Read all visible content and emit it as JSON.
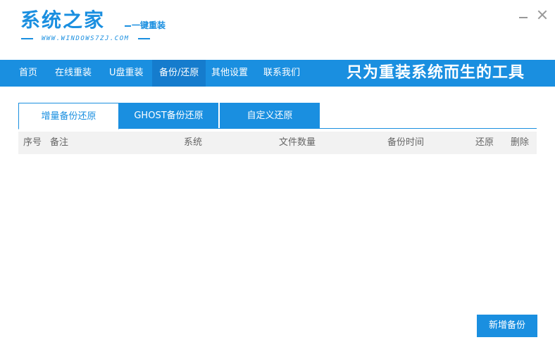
{
  "header": {
    "logo_title": "系统之家",
    "logo_subtitle": "一键重装",
    "logo_url": "WWW.WINDOWS7ZJ.COM"
  },
  "window_controls": {
    "minimize_icon": "minimize-icon",
    "close_icon": "close-icon"
  },
  "nav": {
    "items": [
      {
        "label": "首页",
        "active": false
      },
      {
        "label": "在线重装",
        "active": false
      },
      {
        "label": "U盘重装",
        "active": false
      },
      {
        "label": "备份/还原",
        "active": true
      },
      {
        "label": "其他设置",
        "active": false
      },
      {
        "label": "联系我们",
        "active": false
      }
    ],
    "slogan": "只为重装系统而生的工具"
  },
  "tabs": [
    {
      "label": "增量备份还原",
      "active": true
    },
    {
      "label": "GHOST备份还原",
      "active": false
    },
    {
      "label": "自定义还原",
      "active": false
    }
  ],
  "table": {
    "columns": [
      "序号",
      "备注",
      "系统",
      "文件数量",
      "备份时间",
      "还原",
      "删除"
    ],
    "rows": []
  },
  "actions": {
    "new_backup_label": "新增备份"
  },
  "colors": {
    "accent": "#1a8fe0",
    "nav_active": "#157ccd",
    "table_header_bg": "#f2f2f2"
  }
}
